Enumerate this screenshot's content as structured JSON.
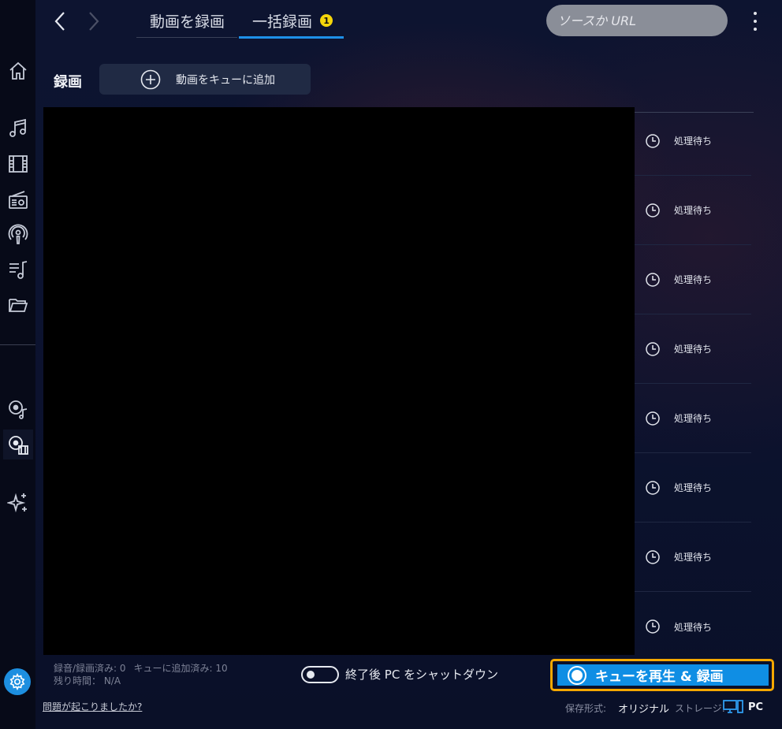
{
  "topbar": {
    "tabs": [
      {
        "label": "動画を録画"
      },
      {
        "label": "一括録画",
        "badge": "1"
      }
    ],
    "search_placeholder": "ソースか URL"
  },
  "section": {
    "title": "録画",
    "add_button_label": "動画をキューに追加"
  },
  "queue": {
    "items": [
      {
        "status": "処理待ち"
      },
      {
        "status": "処理待ち"
      },
      {
        "status": "処理待ち"
      },
      {
        "status": "処理待ち"
      },
      {
        "status": "処理待ち"
      },
      {
        "status": "処理待ち"
      },
      {
        "status": "処理待ち"
      },
      {
        "status": "処理待ち"
      }
    ]
  },
  "footer": {
    "recorded_label": "録音/録画済み: 0",
    "queued_label": "キューに追加済み: 10",
    "remaining_label": "残り時間： N/A",
    "shutdown_label": "終了後 PC をシャットダウン",
    "record_button_label": "キューを再生 & 録画",
    "help_link": "問題が起こりましたか?",
    "format_label": "保存形式:",
    "format_value": "オリジナル",
    "storage_label": "ストレージ:",
    "storage_value": "PC"
  },
  "colors": {
    "accent": "#1e90e8",
    "highlight": "#f5a800",
    "badge": "#f5d60a"
  }
}
